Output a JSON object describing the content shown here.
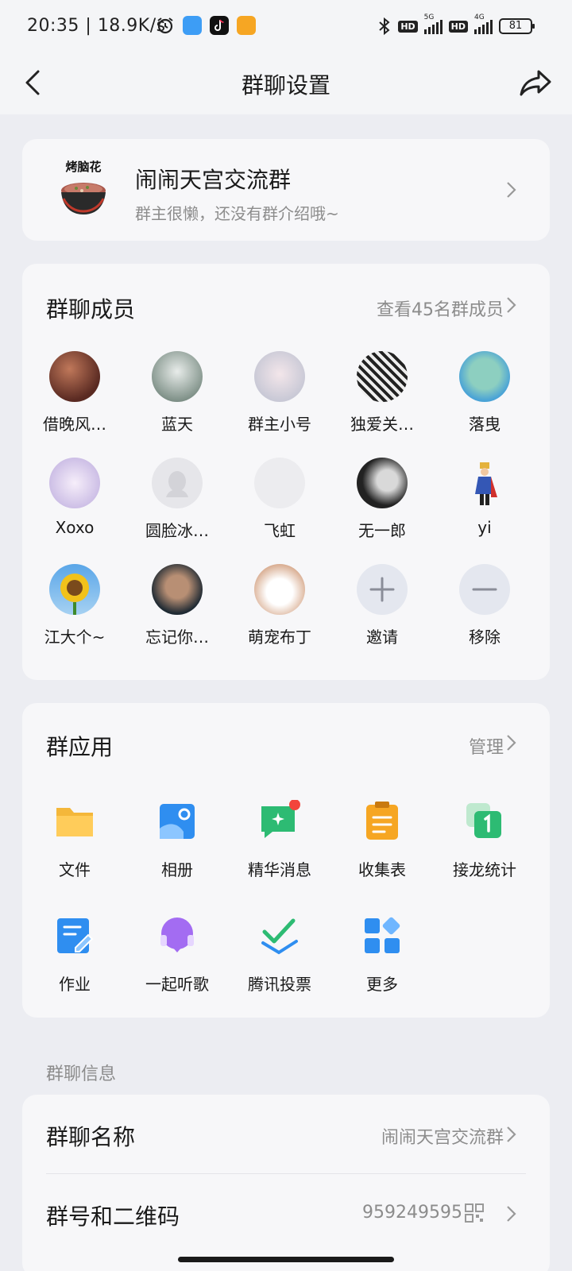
{
  "status": {
    "time": "20:35",
    "speed": "18.9K/s",
    "battery": "81",
    "sig1": "5G",
    "sig2": "4G",
    "hd": "HD"
  },
  "nav": {
    "title": "群聊设置"
  },
  "group": {
    "avatar_text": "烤脑花",
    "name": "闹闹天宫交流群",
    "intro": "群主很懒，还没有群介绍哦~"
  },
  "members": {
    "title": "群聊成员",
    "view_all": "查看45名群成员",
    "items": [
      {
        "name": "借晚风…"
      },
      {
        "name": "蓝天"
      },
      {
        "name": "群主小号"
      },
      {
        "name": "独爱关…"
      },
      {
        "name": "落曳"
      },
      {
        "name": "Xoxo"
      },
      {
        "name": "圆脸冰…"
      },
      {
        "name": "飞虹"
      },
      {
        "name": "无一郎"
      },
      {
        "name": "yi"
      },
      {
        "name": "江大个~"
      },
      {
        "name": "忘记你…"
      },
      {
        "name": "萌宠布丁"
      },
      {
        "name": "邀请"
      },
      {
        "name": "移除"
      }
    ]
  },
  "apps": {
    "title": "群应用",
    "manage": "管理",
    "items": [
      {
        "name": "文件"
      },
      {
        "name": "相册"
      },
      {
        "name": "精华消息"
      },
      {
        "name": "收集表"
      },
      {
        "name": "接龙统计"
      },
      {
        "name": "作业"
      },
      {
        "name": "一起听歌"
      },
      {
        "name": "腾讯投票"
      },
      {
        "name": "更多"
      }
    ]
  },
  "info": {
    "section_label": "群聊信息",
    "name_label": "群聊名称",
    "name_value": "闹闹天宫交流群",
    "number_label": "群号和二维码",
    "number_value": "959249595"
  }
}
